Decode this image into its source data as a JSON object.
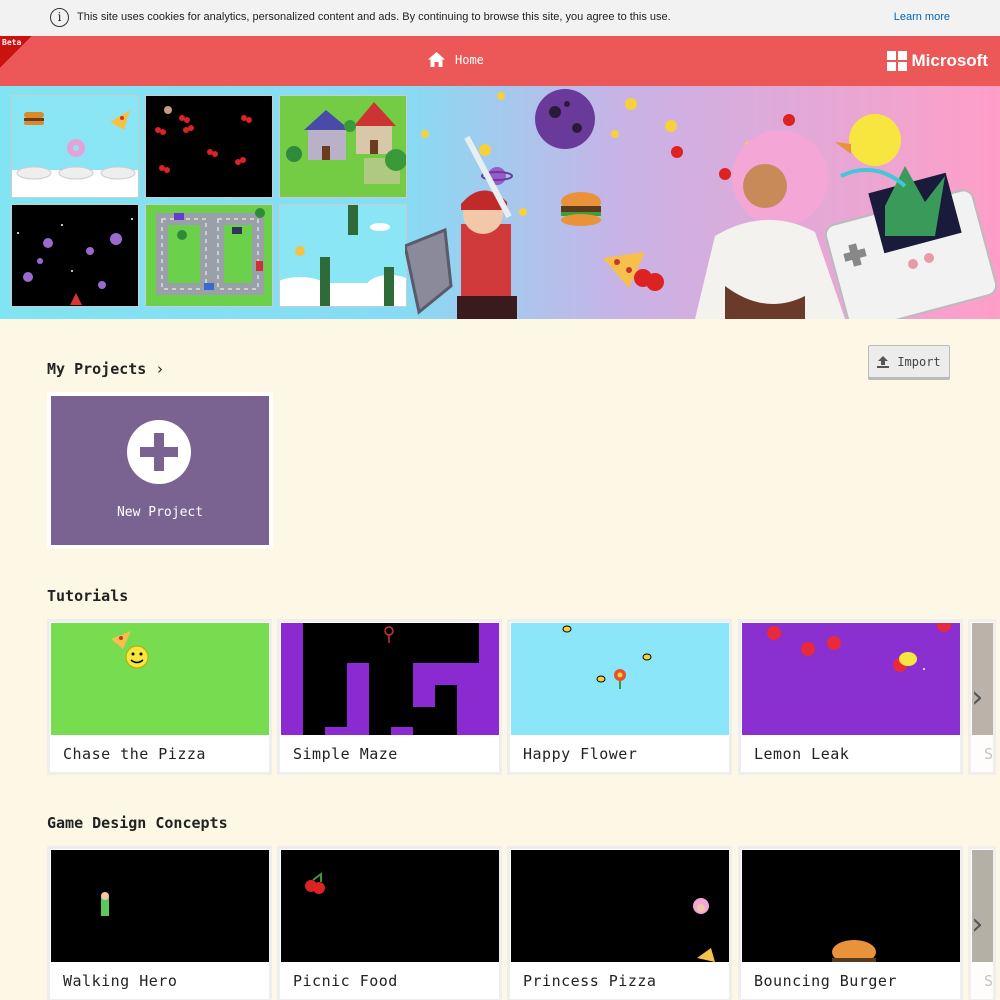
{
  "cookie": {
    "text": "This site uses cookies for analytics, personalized content and ads. By continuing to browse this site, you agree to this use.",
    "link": "Learn more"
  },
  "header": {
    "beta": "Beta",
    "home": "Home",
    "brand": "Microsoft",
    "color": "#ec5758"
  },
  "projects": {
    "title": "My Projects",
    "import": "Import",
    "new_project": "New Project"
  },
  "tutorials": {
    "title": "Tutorials",
    "items": [
      {
        "label": "Chase the Pizza"
      },
      {
        "label": "Simple Maze"
      },
      {
        "label": "Happy Flower"
      },
      {
        "label": "Lemon Leak"
      },
      {
        "label": "Si"
      }
    ]
  },
  "concepts": {
    "title": "Game Design Concepts",
    "items": [
      {
        "label": "Walking Hero"
      },
      {
        "label": "Picnic Food"
      },
      {
        "label": "Princess Pizza"
      },
      {
        "label": "Bouncing Burger"
      },
      {
        "label": "St"
      }
    ]
  }
}
